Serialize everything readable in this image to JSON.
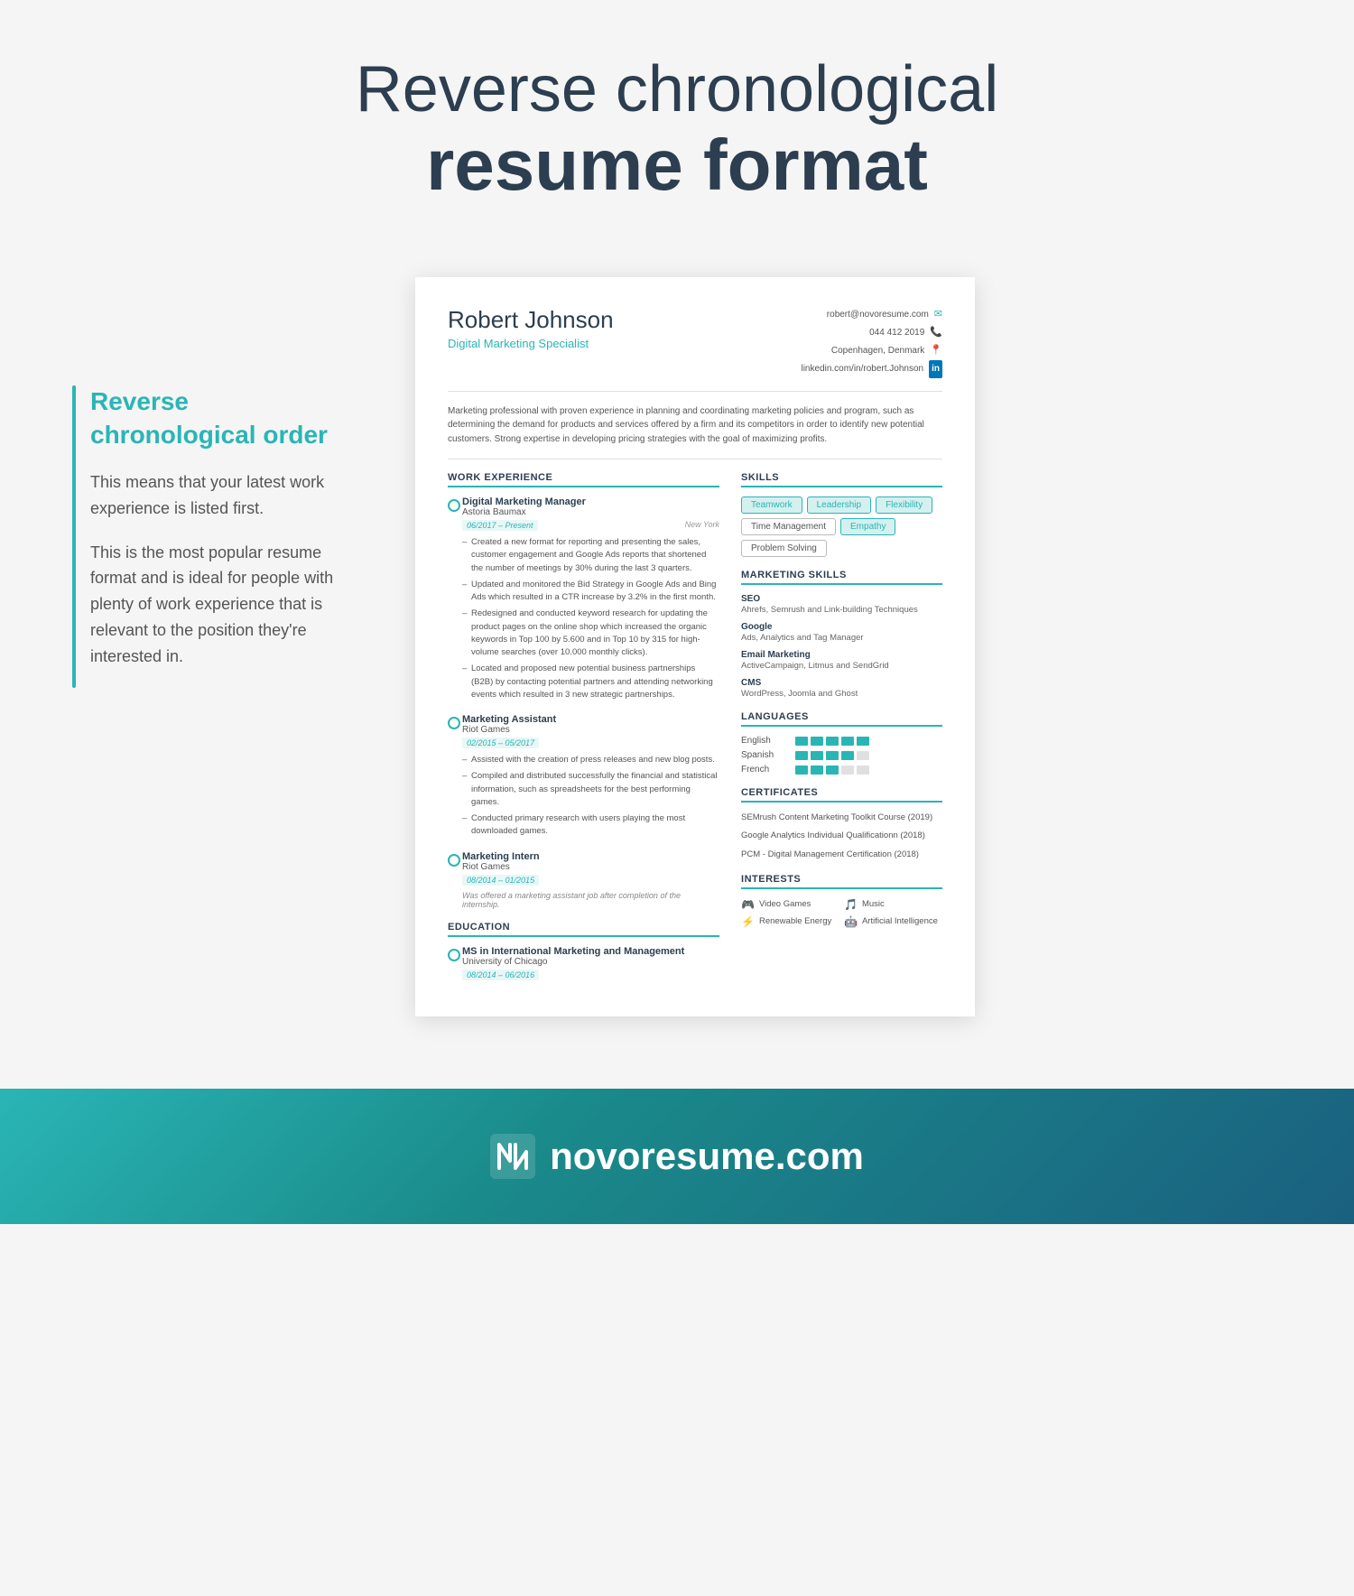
{
  "page": {
    "title_light": "Reverse chronological",
    "title_bold": "resume format"
  },
  "sidebar": {
    "title": "Reverse chronological order",
    "para1": "This means that your latest work experience is listed first.",
    "para2": "This is the most popular resume format and is ideal for people with plenty of work experience that is relevant to the position they're interested in."
  },
  "resume": {
    "name": "Robert Johnson",
    "title": "Digital Marketing Specialist",
    "contact": {
      "email": "robert@novoresume.com",
      "phone": "044 412 2019",
      "location": "Copenhagen, Denmark",
      "linkedin": "linkedin.com/in/robert.Johnson"
    },
    "summary": "Marketing professional with proven experience in planning and coordinating marketing policies and program, such as determining the demand for products and services offered by a firm and its competitors in order to identify new potential customers. Strong expertise in developing pricing strategies with the goal of maximizing profits.",
    "work_experience_title": "WORK EXPERIENCE",
    "jobs": [
      {
        "title": "Digital Marketing Manager",
        "company": "Astoria Baumax",
        "date": "06/2017 – Present",
        "location": "New York",
        "bullets": [
          "Created a new format for reporting and presenting the sales, customer engagement and Google Ads reports that shortened the number of meetings by 30% during the last 3 quarters.",
          "Updated and monitored the Bid Strategy in Google Ads and Bing Ads which resulted in a CTR increase by 3.2% in the first month.",
          "Redesigned and conducted keyword research for updating the product pages on the online shop which increased the organic keywords in Top 100 by 5.600 and in Top 10 by 315 for high-volume searches (over 10.000 monthly clicks).",
          "Located and proposed new potential business partnerships (B2B) by contacting potential partners and attending networking events which resulted in 3 new strategic partnerships."
        ]
      },
      {
        "title": "Marketing Assistant",
        "company": "Riot Games",
        "date": "02/2015 – 05/2017",
        "location": "",
        "bullets": [
          "Assisted with the creation of press releases and new blog posts.",
          "Compiled and distributed successfully the financial and statistical information, such as spreadsheets for the best performing games.",
          "Conducted primary research with users playing the most downloaded games."
        ]
      },
      {
        "title": "Marketing Intern",
        "company": "Riot Games",
        "date": "08/2014 – 01/2015",
        "location": "",
        "bullets": [],
        "note": "Was offered a marketing assistant job after completion of the internship."
      }
    ],
    "education_title": "EDUCATION",
    "education": [
      {
        "degree": "MS in International Marketing and Management",
        "school": "University of Chicago",
        "date": "08/2014 – 06/2016"
      }
    ],
    "skills_title": "SKILLS",
    "skills_tags": [
      {
        "label": "Teamwork",
        "style": "teal"
      },
      {
        "label": "Leadership",
        "style": "teal"
      },
      {
        "label": "Flexibility",
        "style": "teal"
      },
      {
        "label": "Time Management",
        "style": "outline"
      },
      {
        "label": "Empathy",
        "style": "teal"
      },
      {
        "label": "Problem Solving",
        "style": "outline"
      }
    ],
    "marketing_skills_title": "MARKETING SKILLS",
    "marketing_skills": [
      {
        "name": "SEO",
        "desc": "Ahrefs, Semrush and Link-building Techniques"
      },
      {
        "name": "Google",
        "desc": "Ads, Analytics and Tag Manager"
      },
      {
        "name": "Email Marketing",
        "desc": "ActiveCampaign, Litmus and SendGrid"
      },
      {
        "name": "CMS",
        "desc": "WordPress, Joomla and Ghost"
      }
    ],
    "languages_title": "LANGUAGES",
    "languages": [
      {
        "name": "English",
        "level": 5
      },
      {
        "name": "Spanish",
        "level": 4
      },
      {
        "name": "French",
        "level": 3
      }
    ],
    "certificates_title": "CERTIFICATES",
    "certificates": [
      "SEMrush Content Marketing Toolkit Course (2019)",
      "Google Analytics Individual Qualificationn (2018)",
      "PCM - Digital Management Certification (2018)"
    ],
    "interests_title": "INTERESTS",
    "interests": [
      {
        "icon": "🎮",
        "label": "Video Games"
      },
      {
        "icon": "🎵",
        "label": "Music"
      },
      {
        "icon": "⚡",
        "label": "Renewable Energy"
      },
      {
        "icon": "🤖",
        "label": "Artificial Intelligence"
      }
    ]
  },
  "footer": {
    "brand": "novoresume.com"
  }
}
